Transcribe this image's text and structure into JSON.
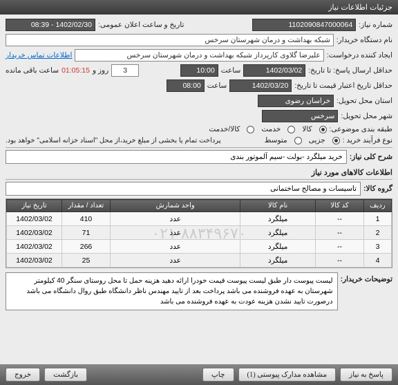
{
  "titlebar": "جزئیات اطلاعات نیاز",
  "labels": {
    "need_no": "شماره نیاز:",
    "announce": "تاریخ و ساعت اعلان عمومی:",
    "buyer_device": "نام دستگاه خریدار:",
    "creator": "ایجاد کننده درخواست:",
    "contact": "اطلاعات تماس خریدار",
    "response_deadline": "حداقل ارسال پاسخ: تا تاریخ:",
    "time_lbl": "ساعت",
    "days_lbl": "روز و",
    "remaining": "ساعت باقی مانده",
    "price_validity": "حداقل تاریخ اعتبار قیمت تا تاریخ:",
    "province": "استان محل تحویل:",
    "city": "شهر محل تحویل:",
    "subject_category": "طبقه بندی موضوعی:",
    "goods": "کالا",
    "service": "خدمت",
    "goods_service": "کالا/خدمت",
    "process": "نوع فرآیند خرید :",
    "low": "جزیی",
    "medium": "متوسط",
    "payment_note": "پرداخت تمام یا بخشی از مبلغ خرید،از محل \"اسناد خزانه اسلامی\" خواهد بود.",
    "summary": "شرح کلی نیاز:",
    "items_info": "اطلاعات کالاهای مورد نیاز",
    "group": "گروه کالا:",
    "buyer_notes": "توضیحات خریدار:"
  },
  "values": {
    "need_no": "1102090847000064",
    "announce": "1402/02/30 - 08:39",
    "buyer_device": "شبکه بهداشت و درمان شهرستان سرخس",
    "creator": "علیرضا گلاوی کارپرداز شبکه بهداشت و درمان شهرستان سرخس",
    "response_date": "1402/03/02",
    "response_time": "10:00",
    "days": "3",
    "countdown": "01:05:15",
    "price_date": "1402/03/20",
    "price_time": "08:00",
    "province": "خراسان رضوی",
    "city": "سرخس",
    "summary": "خرید میلگرد -بولت -سیم آلموتور بندی",
    "group": "تاسیسات و مصالح ساختمانی",
    "notes": "لیست پیوست دار طبق لیست پیوست قیمت خودرا ارائه دهید هزینه حمل تا محل روستای سنگر 40 کیلومتر شهرستان به عهده فروشنده می باشد پرداخت بعد از تایید مهندس ناظر دانشگاه طبق روال دانشگاه می باشد درصورت تایید نشدن هزینه عودت به عهده فروشنده می باشد"
  },
  "watermark": "۰۲۱-۸۸۳۴۹۶۷۰",
  "table": {
    "headers": [
      "ردیف",
      "کد کالا",
      "نام کالا",
      "واحد شمارش",
      "تعداد / مقدار",
      "تاریخ نیاز"
    ],
    "rows": [
      {
        "idx": "1",
        "code": "--",
        "name": "میلگرد",
        "unit": "عدد",
        "qty": "410",
        "date": "1402/03/02"
      },
      {
        "idx": "2",
        "code": "--",
        "name": "میلگرد",
        "unit": "عدد",
        "qty": "71",
        "date": "1402/03/02"
      },
      {
        "idx": "3",
        "code": "--",
        "name": "میلگرد",
        "unit": "عدد",
        "qty": "266",
        "date": "1402/03/02"
      },
      {
        "idx": "4",
        "code": "--",
        "name": "میلگرد",
        "unit": "عدد",
        "qty": "25",
        "date": "1402/03/02"
      }
    ]
  },
  "footer": {
    "respond": "پاسخ به نیاز",
    "attachments": "مشاهده مدارک پیوستی (1)",
    "print": "چاپ",
    "back": "بازگشت",
    "exit": "خروج"
  }
}
